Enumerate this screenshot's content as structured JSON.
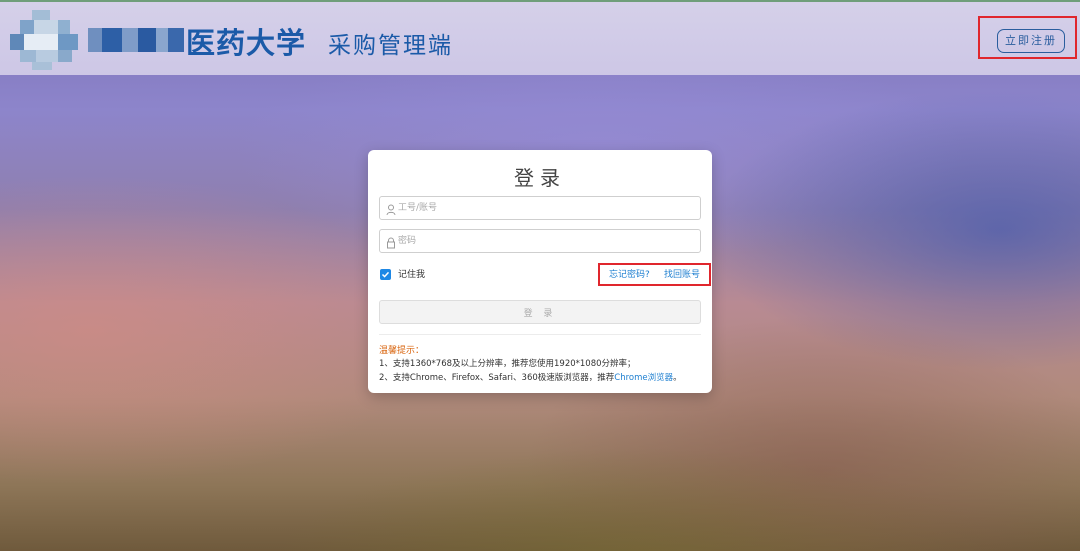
{
  "header": {
    "title_main": "医药大学",
    "title_sub": "采购管理端",
    "register_label": "立即注册"
  },
  "login": {
    "title": "登录",
    "username_placeholder": "工号/账号",
    "password_placeholder": "密码",
    "remember_label": "记住我",
    "remember_checked": true,
    "forgot_password": "忘记密码?",
    "find_account": "找回账号",
    "submit_label": "登 录"
  },
  "tips": {
    "title": "温馨提示：",
    "line1": "1、支持1360*768及以上分辨率，推荐您使用1920*1080分辨率；",
    "line2_prefix": "2、支持Chrome、Firefox、Safari、360极速版浏览器，推荐",
    "line2_link": "Chrome浏览器",
    "line2_suffix": "。"
  },
  "icons": {
    "username": "user-icon",
    "password": "lock-icon",
    "remember": "checkbox-checked-icon"
  },
  "colors": {
    "brand_blue": "#1b5aa8",
    "link_blue": "#1e7fd0",
    "tips_orange": "#d9650f",
    "highlight_red": "#e0262d",
    "checkbox_blue": "#1e88e5"
  }
}
